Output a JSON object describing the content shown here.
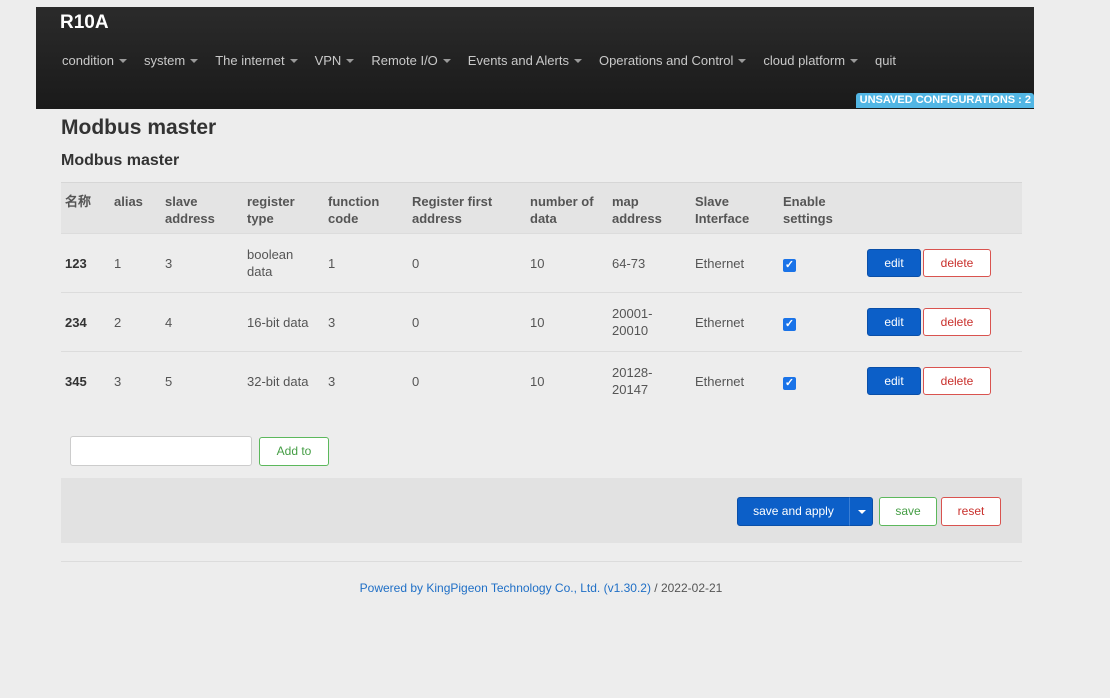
{
  "brand": "R10A",
  "menu": [
    {
      "label": "condition",
      "has_dropdown": true
    },
    {
      "label": "system",
      "has_dropdown": true
    },
    {
      "label": "The internet",
      "has_dropdown": true
    },
    {
      "label": "VPN",
      "has_dropdown": true
    },
    {
      "label": "Remote I/O",
      "has_dropdown": true
    },
    {
      "label": "Events and Alerts",
      "has_dropdown": true
    },
    {
      "label": "Operations and Control",
      "has_dropdown": true
    },
    {
      "label": "cloud platform",
      "has_dropdown": true
    },
    {
      "label": "quit",
      "has_dropdown": false
    }
  ],
  "unsaved_badge": "UNSAVED CONFIGURATIONS : 2",
  "page_title": "Modbus master",
  "section_title": "Modbus master",
  "table": {
    "headers": {
      "name": "名称",
      "alias": "alias",
      "slave_address": "slave address",
      "register_type": "register type",
      "function_code": "function code",
      "register_first_address": "Register first address",
      "number_of_data": "number of data",
      "map_address": "map address",
      "slave_interface": "Slave Interface",
      "enable_settings": "Enable settings"
    },
    "rows": [
      {
        "name": "123",
        "alias": "1",
        "slave_address": "3",
        "register_type": "boolean data",
        "function_code": "1",
        "register_first_address": "0",
        "number_of_data": "10",
        "map_address": "64-73",
        "slave_interface": "Ethernet",
        "enabled": true
      },
      {
        "name": "234",
        "alias": "2",
        "slave_address": "4",
        "register_type": "16-bit data",
        "function_code": "3",
        "register_first_address": "0",
        "number_of_data": "10",
        "map_address": "20001-20010",
        "slave_interface": "Ethernet",
        "enabled": true
      },
      {
        "name": "345",
        "alias": "3",
        "slave_address": "5",
        "register_type": "32-bit data",
        "function_code": "3",
        "register_first_address": "0",
        "number_of_data": "10",
        "map_address": "20128-20147",
        "slave_interface": "Ethernet",
        "enabled": true
      }
    ],
    "edit_label": "edit",
    "delete_label": "delete"
  },
  "add": {
    "input_value": "",
    "button_label": "Add to"
  },
  "actions": {
    "save_apply_label": "save and apply",
    "save_label": "save",
    "reset_label": "reset"
  },
  "footer": {
    "link_text": "Powered by KingPigeon Technology Co., Ltd. (v1.30.2)",
    "date_text": " / 2022-02-21"
  },
  "colors": {
    "accent_blue": "#0c5fc8",
    "badge_blue": "#52b6e4",
    "danger": "#d9534f",
    "success": "#5cb85c"
  }
}
